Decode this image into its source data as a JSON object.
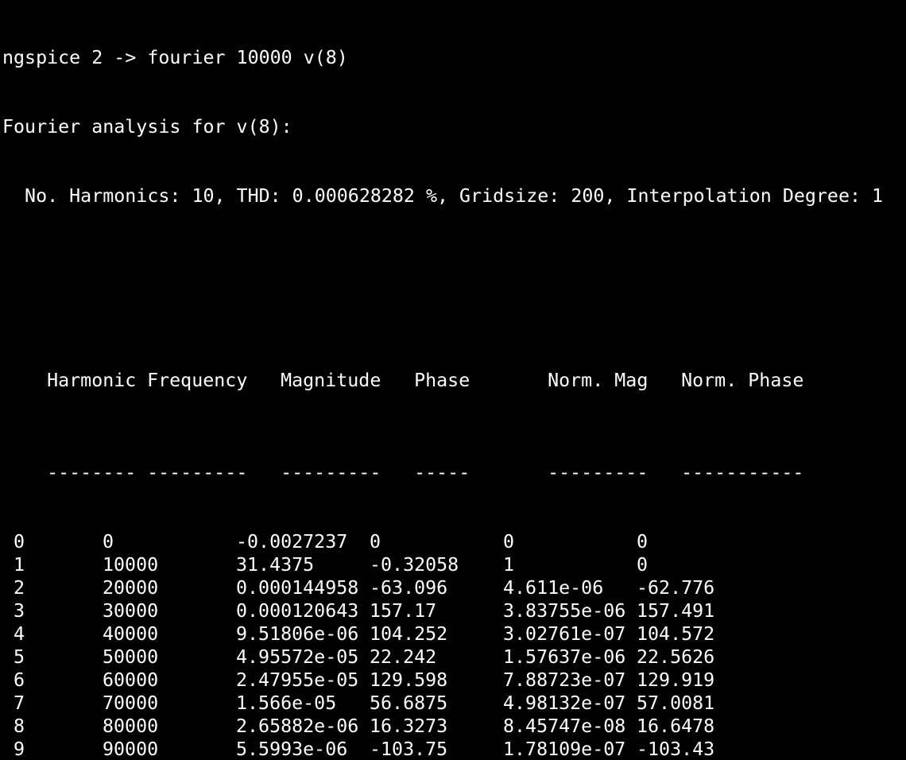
{
  "terminal": {
    "command_line": "ngspice 2 -> fourier 10000 v(8)",
    "analysis_title": "Fourier analysis for v(8):",
    "summary_line": "  No. Harmonics: 10, THD: 0.000628282 %, Gridsize: 200, Interpolation Degree: 1"
  },
  "table": {
    "headers": {
      "harmonic": "Harmonic",
      "frequency": "Frequency",
      "magnitude": "Magnitude",
      "phase": "Phase",
      "norm_mag": "Norm. Mag",
      "norm_phase": "Norm. Phase"
    },
    "separators": {
      "harmonic": "--------",
      "frequency": "---------",
      "magnitude": "---------",
      "phase": "-----",
      "norm_mag": "---------",
      "norm_phase": "-----------"
    },
    "rows": [
      {
        "harmonic": " 0",
        "frequency": "0",
        "magnitude": "-0.0027237",
        "phase": "0",
        "norm_mag": "0",
        "norm_phase": "0"
      },
      {
        "harmonic": " 1",
        "frequency": "10000",
        "magnitude": "31.4375",
        "phase": "-0.32058",
        "norm_mag": "1",
        "norm_phase": "0"
      },
      {
        "harmonic": " 2",
        "frequency": "20000",
        "magnitude": "0.000144958",
        "phase": "-63.096",
        "norm_mag": "4.611e-06",
        "norm_phase": "-62.776"
      },
      {
        "harmonic": " 3",
        "frequency": "30000",
        "magnitude": "0.000120643",
        "phase": "157.17",
        "norm_mag": "3.83755e-06",
        "norm_phase": "157.491"
      },
      {
        "harmonic": " 4",
        "frequency": "40000",
        "magnitude": "9.51806e-06",
        "phase": "104.252",
        "norm_mag": "3.02761e-07",
        "norm_phase": "104.572"
      },
      {
        "harmonic": " 5",
        "frequency": "50000",
        "magnitude": "4.95572e-05",
        "phase": "22.242",
        "norm_mag": "1.57637e-06",
        "norm_phase": "22.5626"
      },
      {
        "harmonic": " 6",
        "frequency": "60000",
        "magnitude": "2.47955e-05",
        "phase": "129.598",
        "norm_mag": "7.88723e-07",
        "norm_phase": "129.919"
      },
      {
        "harmonic": " 7",
        "frequency": "70000",
        "magnitude": "1.566e-05",
        "phase": "56.6875",
        "norm_mag": "4.98132e-07",
        "norm_phase": "57.0081"
      },
      {
        "harmonic": " 8",
        "frequency": "80000",
        "magnitude": "2.65882e-06",
        "phase": "16.3273",
        "norm_mag": "8.45747e-08",
        "norm_phase": "16.6478"
      },
      {
        "harmonic": " 9",
        "frequency": "90000",
        "magnitude": "5.5993e-06",
        "phase": "-103.75",
        "norm_mag": "1.78109e-07",
        "norm_phase": "-103.43"
      }
    ]
  },
  "colors": {
    "background": "#000000",
    "foreground": "#ffffff"
  }
}
